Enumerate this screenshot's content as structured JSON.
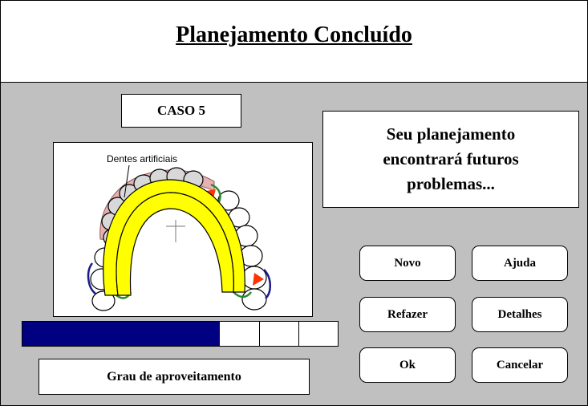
{
  "window": {
    "title": "Planejamento Concluído"
  },
  "case_label": "CASO 5",
  "message": {
    "line1": "Seu planejamento",
    "line2": "encontrará futuros",
    "line3": "problemas..."
  },
  "illustration": {
    "annotation": "Dentes artificiais"
  },
  "progress": {
    "label": "Grau de aproveitamento",
    "segments_total": 8,
    "segments_filled": 5,
    "fill_color": "#000080"
  },
  "buttons": {
    "novo": "Novo",
    "ajuda": "Ajuda",
    "refazer": "Refazer",
    "detalhes": "Detalhes",
    "ok": "Ok",
    "cancelar": "Cancelar"
  }
}
